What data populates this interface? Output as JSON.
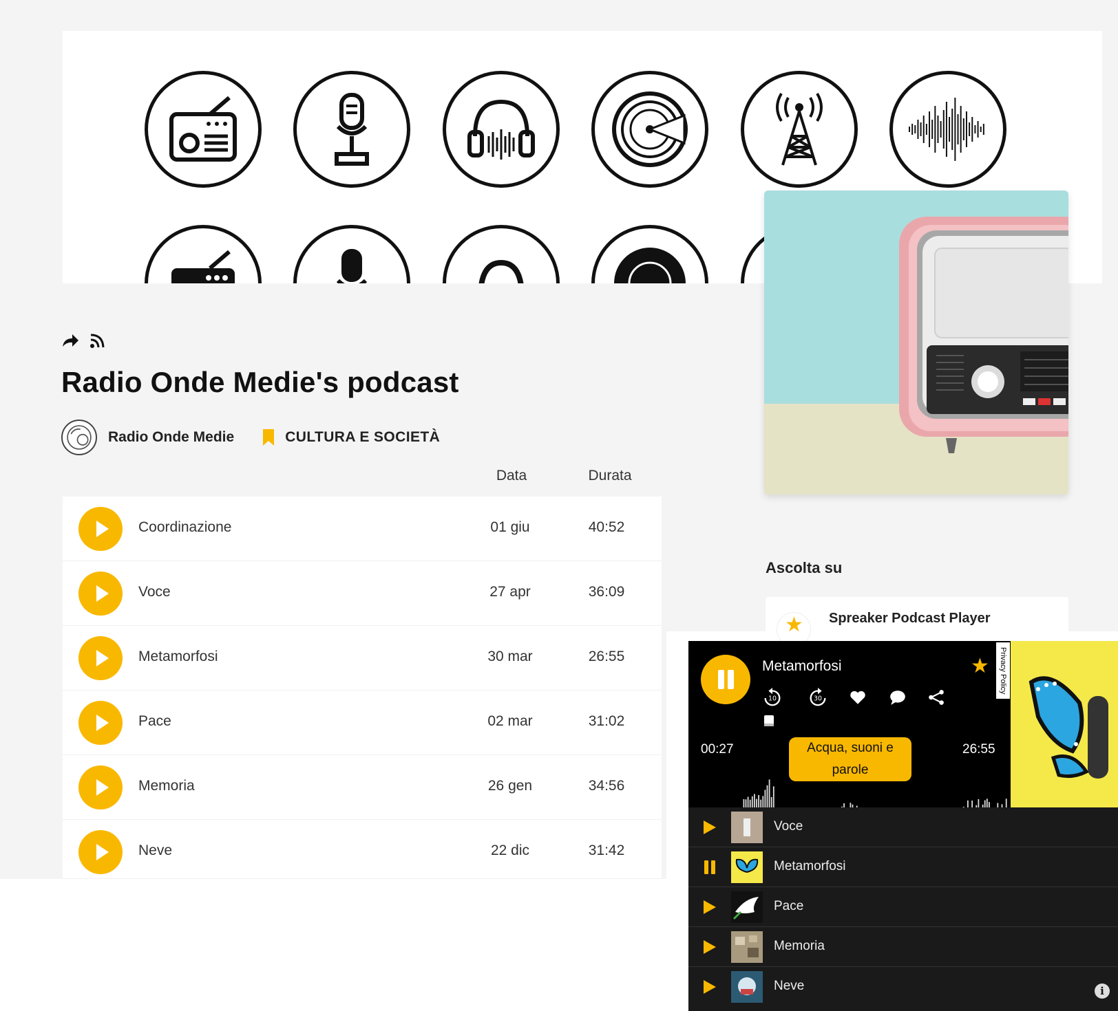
{
  "podcast": {
    "title": "Radio Onde Medie's podcast",
    "author": "Radio Onde Medie",
    "category": "CULTURA E SOCIETÀ"
  },
  "table": {
    "col_data": "Data",
    "col_durata": "Durata"
  },
  "episodes": [
    {
      "title": "Coordinazione",
      "date": "01 giu",
      "duration": "40:52"
    },
    {
      "title": "Voce",
      "date": "27 apr",
      "duration": "36:09"
    },
    {
      "title": "Metamorfosi",
      "date": "30 mar",
      "duration": "26:55"
    },
    {
      "title": "Pace",
      "date": "02 mar",
      "duration": "31:02"
    },
    {
      "title": "Memoria",
      "date": "26 gen",
      "duration": "34:56"
    },
    {
      "title": "Neve",
      "date": "22 dic",
      "duration": "31:42"
    }
  ],
  "ascolta": {
    "title": "Ascolta su",
    "spreaker": "Spreaker Podcast Player"
  },
  "player": {
    "now_playing": "Metamorfosi",
    "current_time": "00:27",
    "total_time": "26:55",
    "chapter": "Acqua, suoni e parole",
    "privacy": "Privacy Policy",
    "rewind_label": "10",
    "forward_label": "30",
    "info": "i",
    "playlist": [
      {
        "title": "Voce",
        "state": "play"
      },
      {
        "title": "Metamorfosi",
        "state": "pause"
      },
      {
        "title": "Pace",
        "state": "play"
      },
      {
        "title": "Memoria",
        "state": "play"
      },
      {
        "title": "Neve",
        "state": "play"
      }
    ]
  },
  "colors": {
    "accent": "#f9b800",
    "background": "#f4f4f4",
    "player_bg": "#1a1a1a"
  },
  "icons": [
    "share-icon",
    "rss-icon",
    "bookmark-icon",
    "radio-icon",
    "microphone-icon",
    "headphones-icon",
    "vinyl-icon",
    "antenna-tower-icon",
    "sound-wave-icon",
    "star-icon",
    "heart-icon",
    "comment-icon",
    "book-icon",
    "info-icon"
  ]
}
